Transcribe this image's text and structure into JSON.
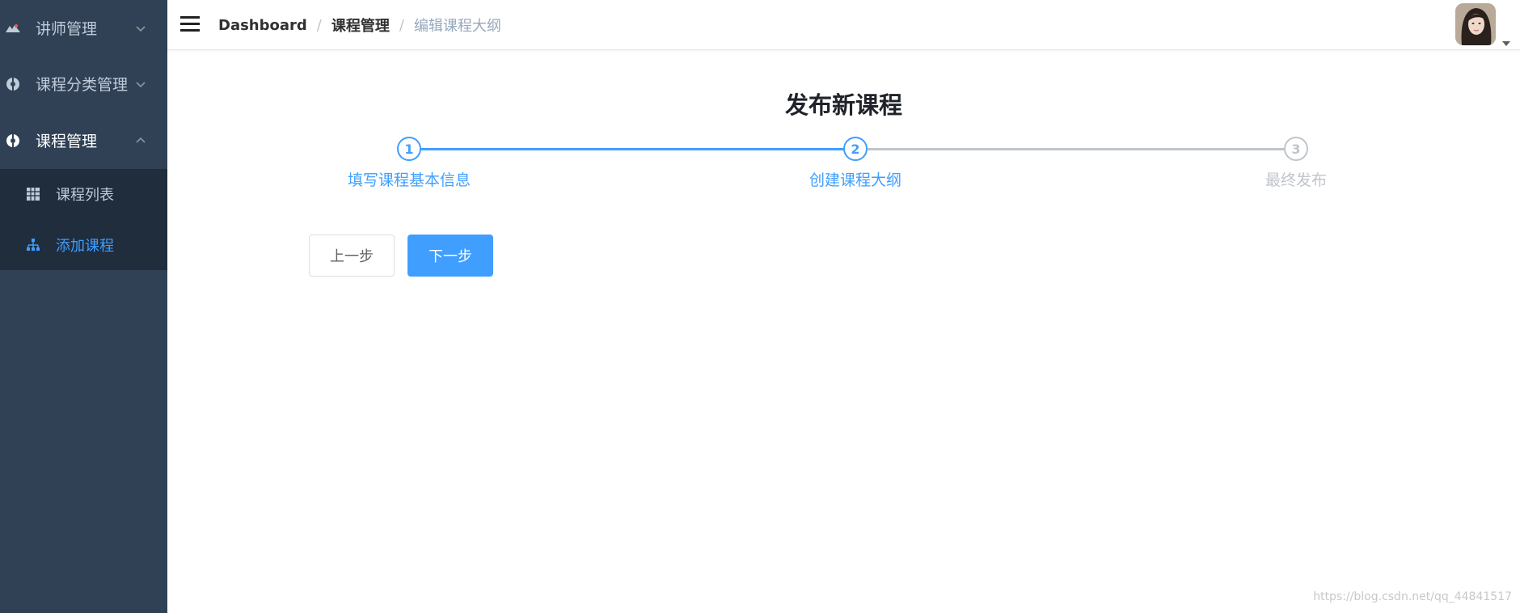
{
  "sidebar": {
    "menus": [
      {
        "label": "讲师管理",
        "icon": "teacher-icon",
        "expanded": false
      },
      {
        "label": "课程分类管理",
        "icon": "category-icon",
        "expanded": false
      },
      {
        "label": "课程管理",
        "icon": "course-icon",
        "expanded": true
      }
    ],
    "submenu": [
      {
        "label": "课程列表",
        "icon": "table-icon",
        "selected": false
      },
      {
        "label": "添加课程",
        "icon": "tree-icon",
        "selected": true
      }
    ]
  },
  "navbar": {
    "breadcrumb": [
      "Dashboard",
      "课程管理",
      "编辑课程大纲"
    ]
  },
  "main": {
    "title": "发布新课程",
    "steps": [
      {
        "number": "1",
        "label": "填写课程基本信息",
        "status": "done"
      },
      {
        "number": "2",
        "label": "创建课程大纲",
        "status": "current"
      },
      {
        "number": "3",
        "label": "最终发布",
        "status": "todo"
      }
    ],
    "buttons": {
      "prev": "上一步",
      "next": "下一步"
    }
  },
  "watermark": "https://blog.csdn.net/qq_44841517",
  "colors": {
    "sidebar_bg": "#304156",
    "submenu_bg": "#1f2d3d",
    "accent": "#409eff",
    "muted": "#c0c4cc"
  }
}
